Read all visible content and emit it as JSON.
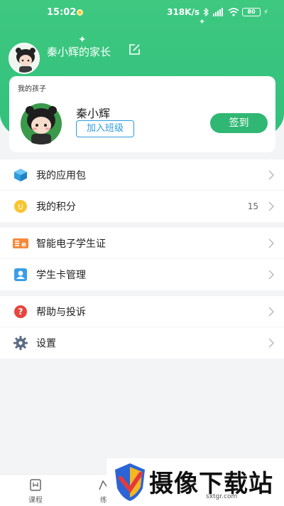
{
  "status_bar": {
    "time": "15:02",
    "speed": "318K/s",
    "battery": "80"
  },
  "header": {
    "parent_name": "秦小辉的家长"
  },
  "child_card": {
    "title": "我的孩子",
    "child_name": "秦小辉",
    "join_class_label": "加入班级",
    "signin_label": "签到"
  },
  "menu_groups": [
    {
      "items": [
        {
          "label": "我的应用包",
          "icon": "package-cube-icon",
          "value": ""
        },
        {
          "label": "我的积分",
          "icon": "points-coin-icon",
          "value": "15"
        }
      ]
    },
    {
      "items": [
        {
          "label": "智能电子学生证",
          "icon": "student-id-card-icon",
          "value": ""
        },
        {
          "label": "学生卡管理",
          "icon": "person-card-icon",
          "value": ""
        }
      ]
    },
    {
      "items": [
        {
          "label": "帮助与投诉",
          "icon": "help-question-icon",
          "value": ""
        },
        {
          "label": "设置",
          "icon": "gear-icon",
          "value": ""
        }
      ]
    }
  ],
  "bottom_nav": [
    {
      "label": "课程",
      "icon": "course-book-icon"
    },
    {
      "label": "练",
      "icon": "practice-icon"
    }
  ],
  "watermark": {
    "text": "摄像下载站",
    "url": "sxtgr.com"
  },
  "colors": {
    "brand_green": "#31c07c",
    "signin_green": "#31b774",
    "link_blue": "#2f9cdc"
  }
}
